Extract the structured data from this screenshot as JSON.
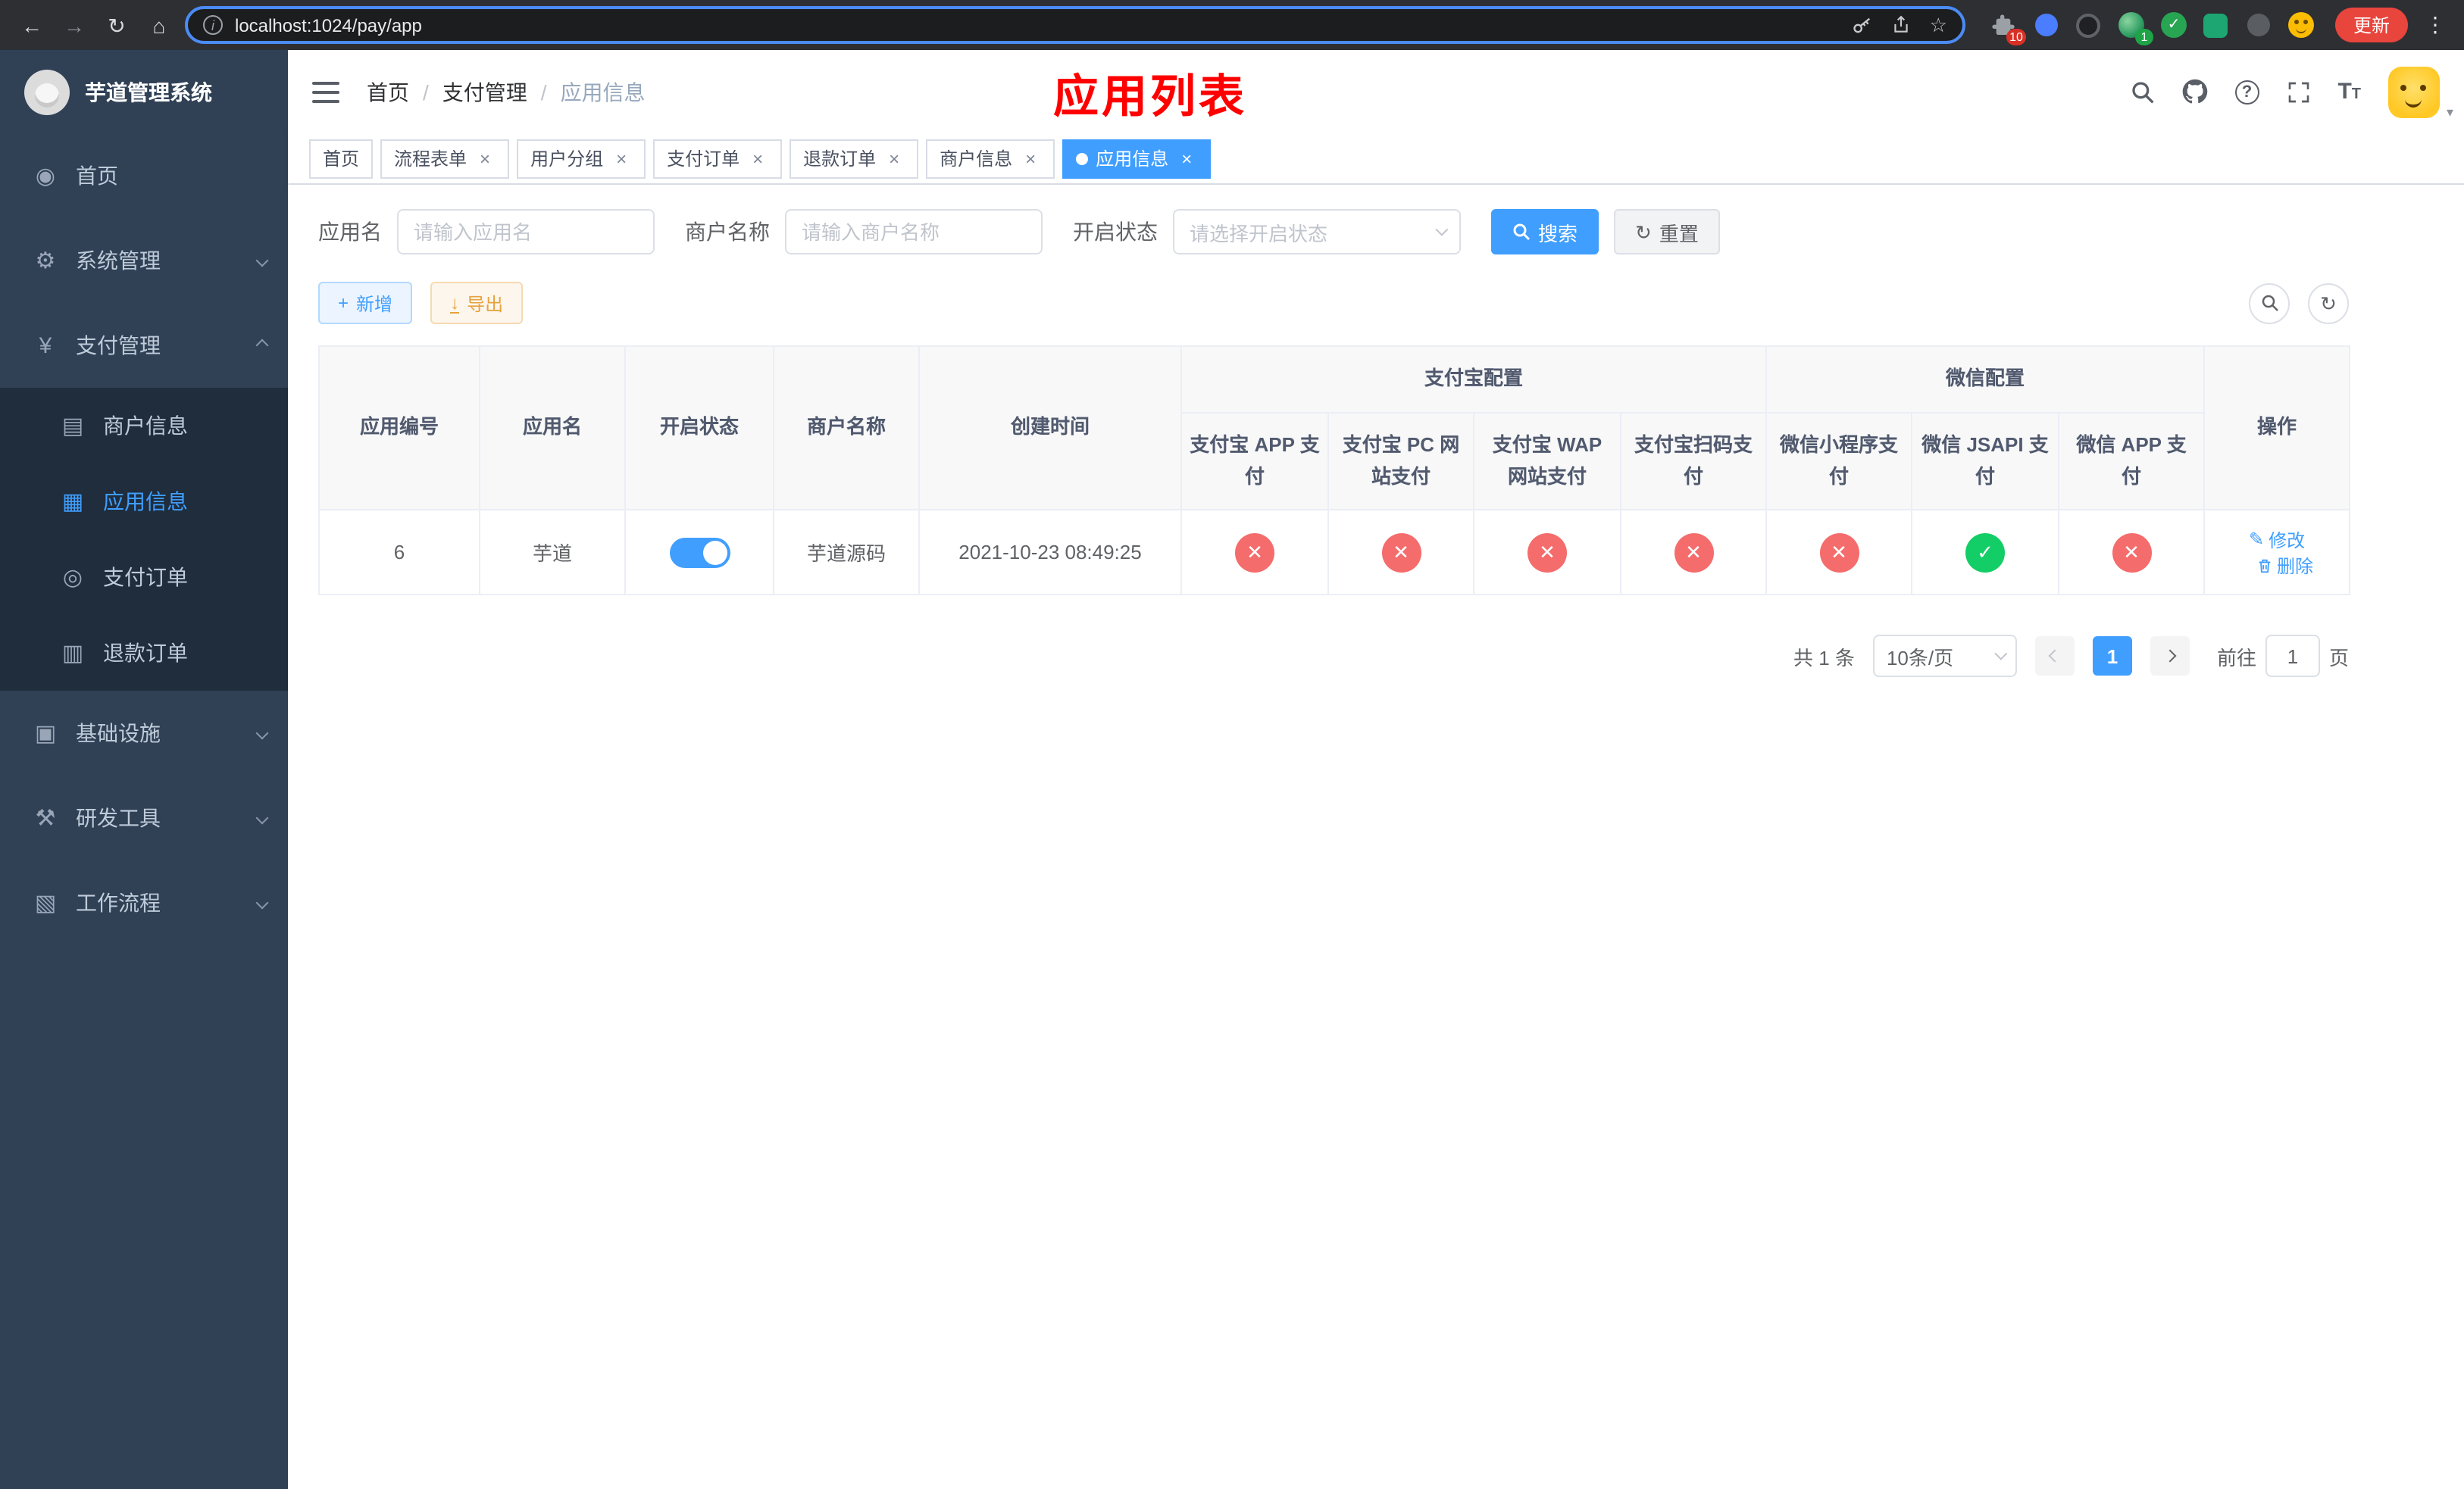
{
  "browser": {
    "url": "localhost:1024/pay/app",
    "update_button": "更新",
    "extensions_badge": "10",
    "profile_badge": "1"
  },
  "icons": {
    "back": "←",
    "forward": "→",
    "reload": "↻",
    "home": "⌂",
    "info": "i",
    "star": "☆",
    "menu_dots": "⋮",
    "dashboard": "◉",
    "gear": "⚙",
    "yen": "¥",
    "card": "▤",
    "grid": "▦",
    "order": "◎",
    "refund": "▥",
    "infra": "▣",
    "tools": "⚒",
    "workflow": "▧",
    "refresh": "↻",
    "plus": "+",
    "download": "↓",
    "close": "×",
    "check": "✓",
    "cross": "✕",
    "edit": "✎",
    "question": "?",
    "caret": "▾",
    "font_size": "T",
    "extension_check": "✓"
  },
  "sidebar": {
    "title": "芋道管理系统",
    "menu": {
      "home": "首页",
      "system": "系统管理",
      "payment": "支付管理",
      "merchant_info": "商户信息",
      "app_info": "应用信息",
      "pay_order": "支付订单",
      "refund_order": "退款订单",
      "infrastructure": "基础设施",
      "dev_tools": "研发工具",
      "workflow": "工作流程"
    }
  },
  "header": {
    "breadcrumb": {
      "home": "首页",
      "section": "支付管理",
      "current": "应用信息",
      "separator": "/"
    },
    "page_title": "应用列表"
  },
  "tabs": [
    {
      "label": "首页"
    },
    {
      "label": "流程表单"
    },
    {
      "label": "用户分组"
    },
    {
      "label": "支付订单"
    },
    {
      "label": "退款订单"
    },
    {
      "label": "商户信息"
    },
    {
      "label": "应用信息"
    }
  ],
  "filters": {
    "app_name": {
      "label": "应用名",
      "placeholder": "请输入应用名",
      "value": ""
    },
    "merchant_name": {
      "label": "商户名称",
      "placeholder": "请输入商户名称",
      "value": ""
    },
    "status": {
      "label": "开启状态",
      "placeholder": "请选择开启状态",
      "value": ""
    },
    "search_button": "搜索",
    "reset_button": "重置"
  },
  "toolbar": {
    "add_button": "新增",
    "export_button": "导出"
  },
  "table": {
    "headers": {
      "app_id": "应用编号",
      "app_name": "应用名",
      "status": "开启状态",
      "merchant_name": "商户名称",
      "create_time": "创建时间",
      "alipay_group": "支付宝配置",
      "wechat_group": "微信配置",
      "alipay_app": "支付宝 APP 支付",
      "alipay_pc": "支付宝 PC 网站支付",
      "alipay_wap": "支付宝 WAP 网站支付",
      "alipay_qr": "支付宝扫码支付",
      "wechat_lite": "微信小程序支付",
      "wechat_jsapi": "微信 JSAPI 支付",
      "wechat_app": "微信 APP 支付",
      "actions": "操作"
    },
    "rows": [
      {
        "app_id": "6",
        "app_name": "芋道",
        "status_enabled": true,
        "merchant_name": "芋道源码",
        "create_time": "2021-10-23 08:49:25",
        "alipay_app": "closed",
        "alipay_pc": "closed",
        "alipay_wap": "closed",
        "alipay_qr": "closed",
        "wechat_lite": "closed",
        "wechat_jsapi": "opened",
        "wechat_app": "closed",
        "edit_action": "修改",
        "delete_action": "删除"
      }
    ]
  },
  "pagination": {
    "total_text": "共 1 条",
    "page_size": "10条/页",
    "current_page": "1",
    "goto_label": "前往",
    "goto_value": "1",
    "goto_suffix": "页"
  },
  "colors": {
    "primary": "#409eff",
    "success": "#13ce66",
    "danger": "#f56c6c",
    "warning": "#e6a23c",
    "title_red": "#ff0000",
    "sidebar_bg": "#304156",
    "sidebar_sub_bg": "#1f2d3d"
  }
}
